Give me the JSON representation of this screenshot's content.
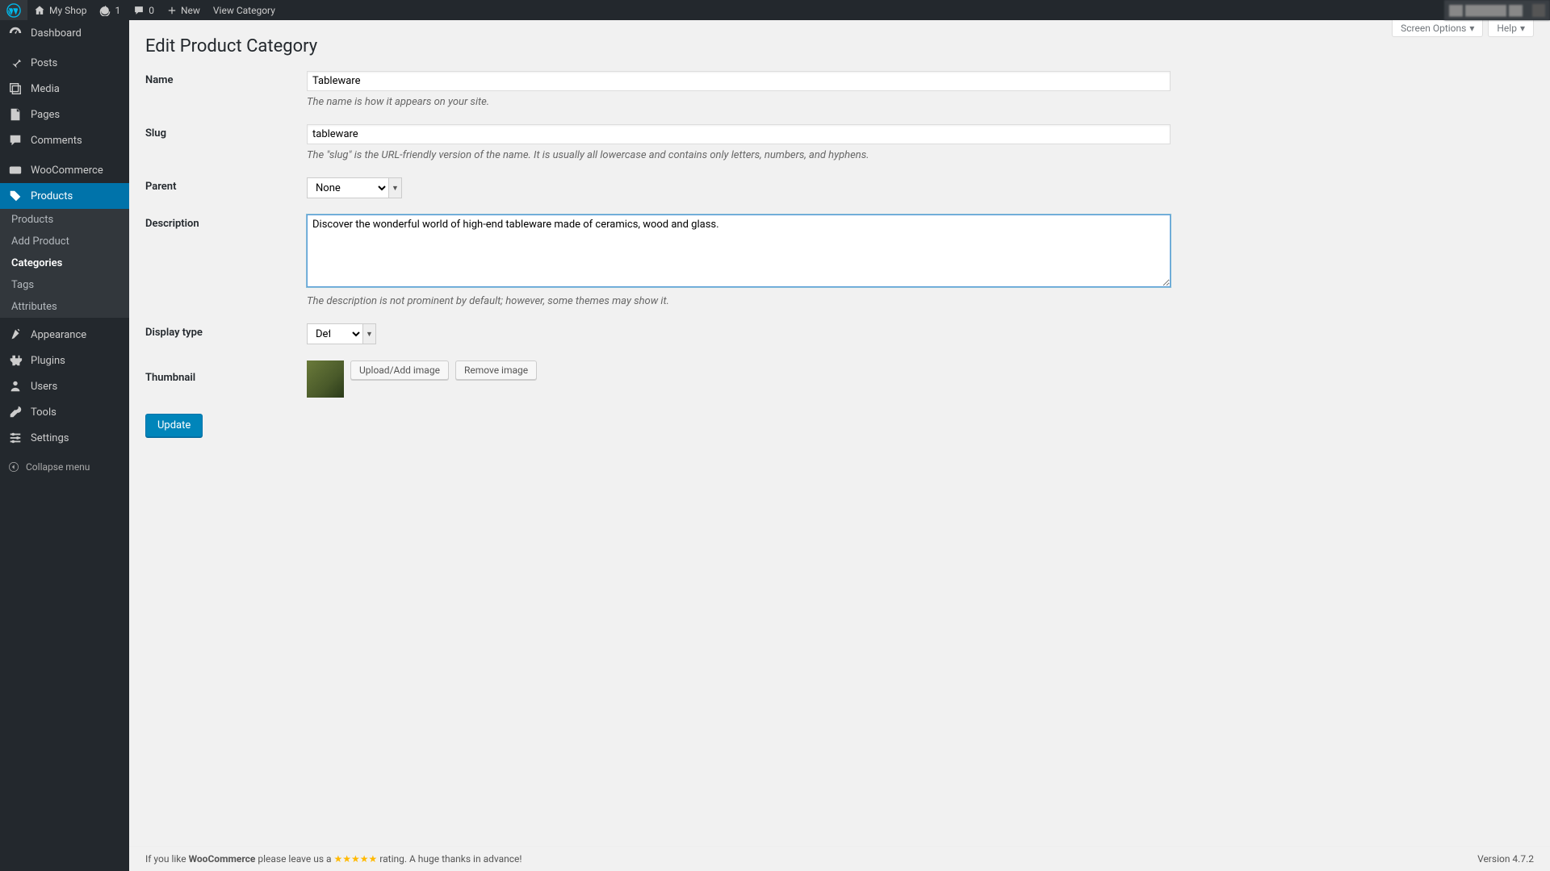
{
  "adminbar": {
    "site_name": "My Shop",
    "updates_count": "1",
    "comments_count": "0",
    "new_label": "New",
    "view_label": "View Category"
  },
  "screen_meta": {
    "screen_options": "Screen Options",
    "help": "Help"
  },
  "sidebar": {
    "dashboard": "Dashboard",
    "posts": "Posts",
    "media": "Media",
    "pages": "Pages",
    "comments": "Comments",
    "woocommerce": "WooCommerce",
    "products": "Products",
    "appearance": "Appearance",
    "plugins": "Plugins",
    "users": "Users",
    "tools": "Tools",
    "settings": "Settings",
    "collapse": "Collapse menu",
    "sub": {
      "products": "Products",
      "add_product": "Add Product",
      "categories": "Categories",
      "tags": "Tags",
      "attributes": "Attributes"
    }
  },
  "page": {
    "title": "Edit Product Category",
    "name_label": "Name",
    "name_value": "Tableware",
    "name_hint": "The name is how it appears on your site.",
    "slug_label": "Slug",
    "slug_value": "tableware",
    "slug_hint": "The \"slug\" is the URL-friendly version of the name. It is usually all lowercase and contains only letters, numbers, and hyphens.",
    "parent_label": "Parent",
    "parent_value": "None",
    "description_label": "Description",
    "description_value": "Discover the wonderful world of high-end tableware made of ceramics, wood and glass.",
    "description_hint": "The description is not prominent by default; however, some themes may show it.",
    "display_type_label": "Display type",
    "display_type_value": "Default",
    "thumbnail_label": "Thumbnail",
    "upload_btn": "Upload/Add image",
    "remove_btn": "Remove image",
    "update_btn": "Update"
  },
  "footer": {
    "prefix": "If you like ",
    "product": "WooCommerce",
    "mid": " please leave us a ",
    "stars": "★★★★★",
    "suffix": " rating. A huge thanks in advance!",
    "version": "Version 4.7.2"
  }
}
